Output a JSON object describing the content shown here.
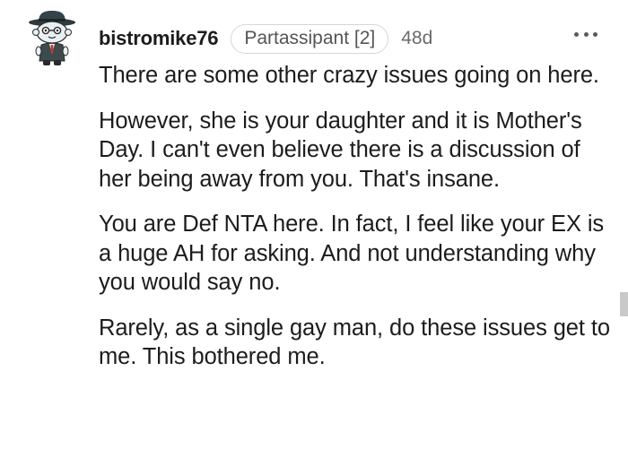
{
  "comment": {
    "username": "bistromike76",
    "flair": "Partassipant [2]",
    "age": "48d",
    "avatar_icon": "snoo-avatar-icon",
    "more_icon": "more-options-icon",
    "paragraphs": [
      "There are some other crazy issues going on here.",
      "However, she is your daughter and it is Mother's Day. I can't even believe there is a discussion of her being away from you. That's insane.",
      "You are Def NTA here. In fact, I feel like your EX is a huge AH for asking. And not understanding why you would say no.",
      "Rarely, as a single gay man, do these issues get to me. This bothered me."
    ]
  },
  "colors": {
    "text": "#1c1c1c",
    "muted": "#6a6a6a",
    "flair_border": "#d6d6d6",
    "avatar_hat": "#2f3b3f",
    "avatar_face": "#e8f0f2"
  }
}
